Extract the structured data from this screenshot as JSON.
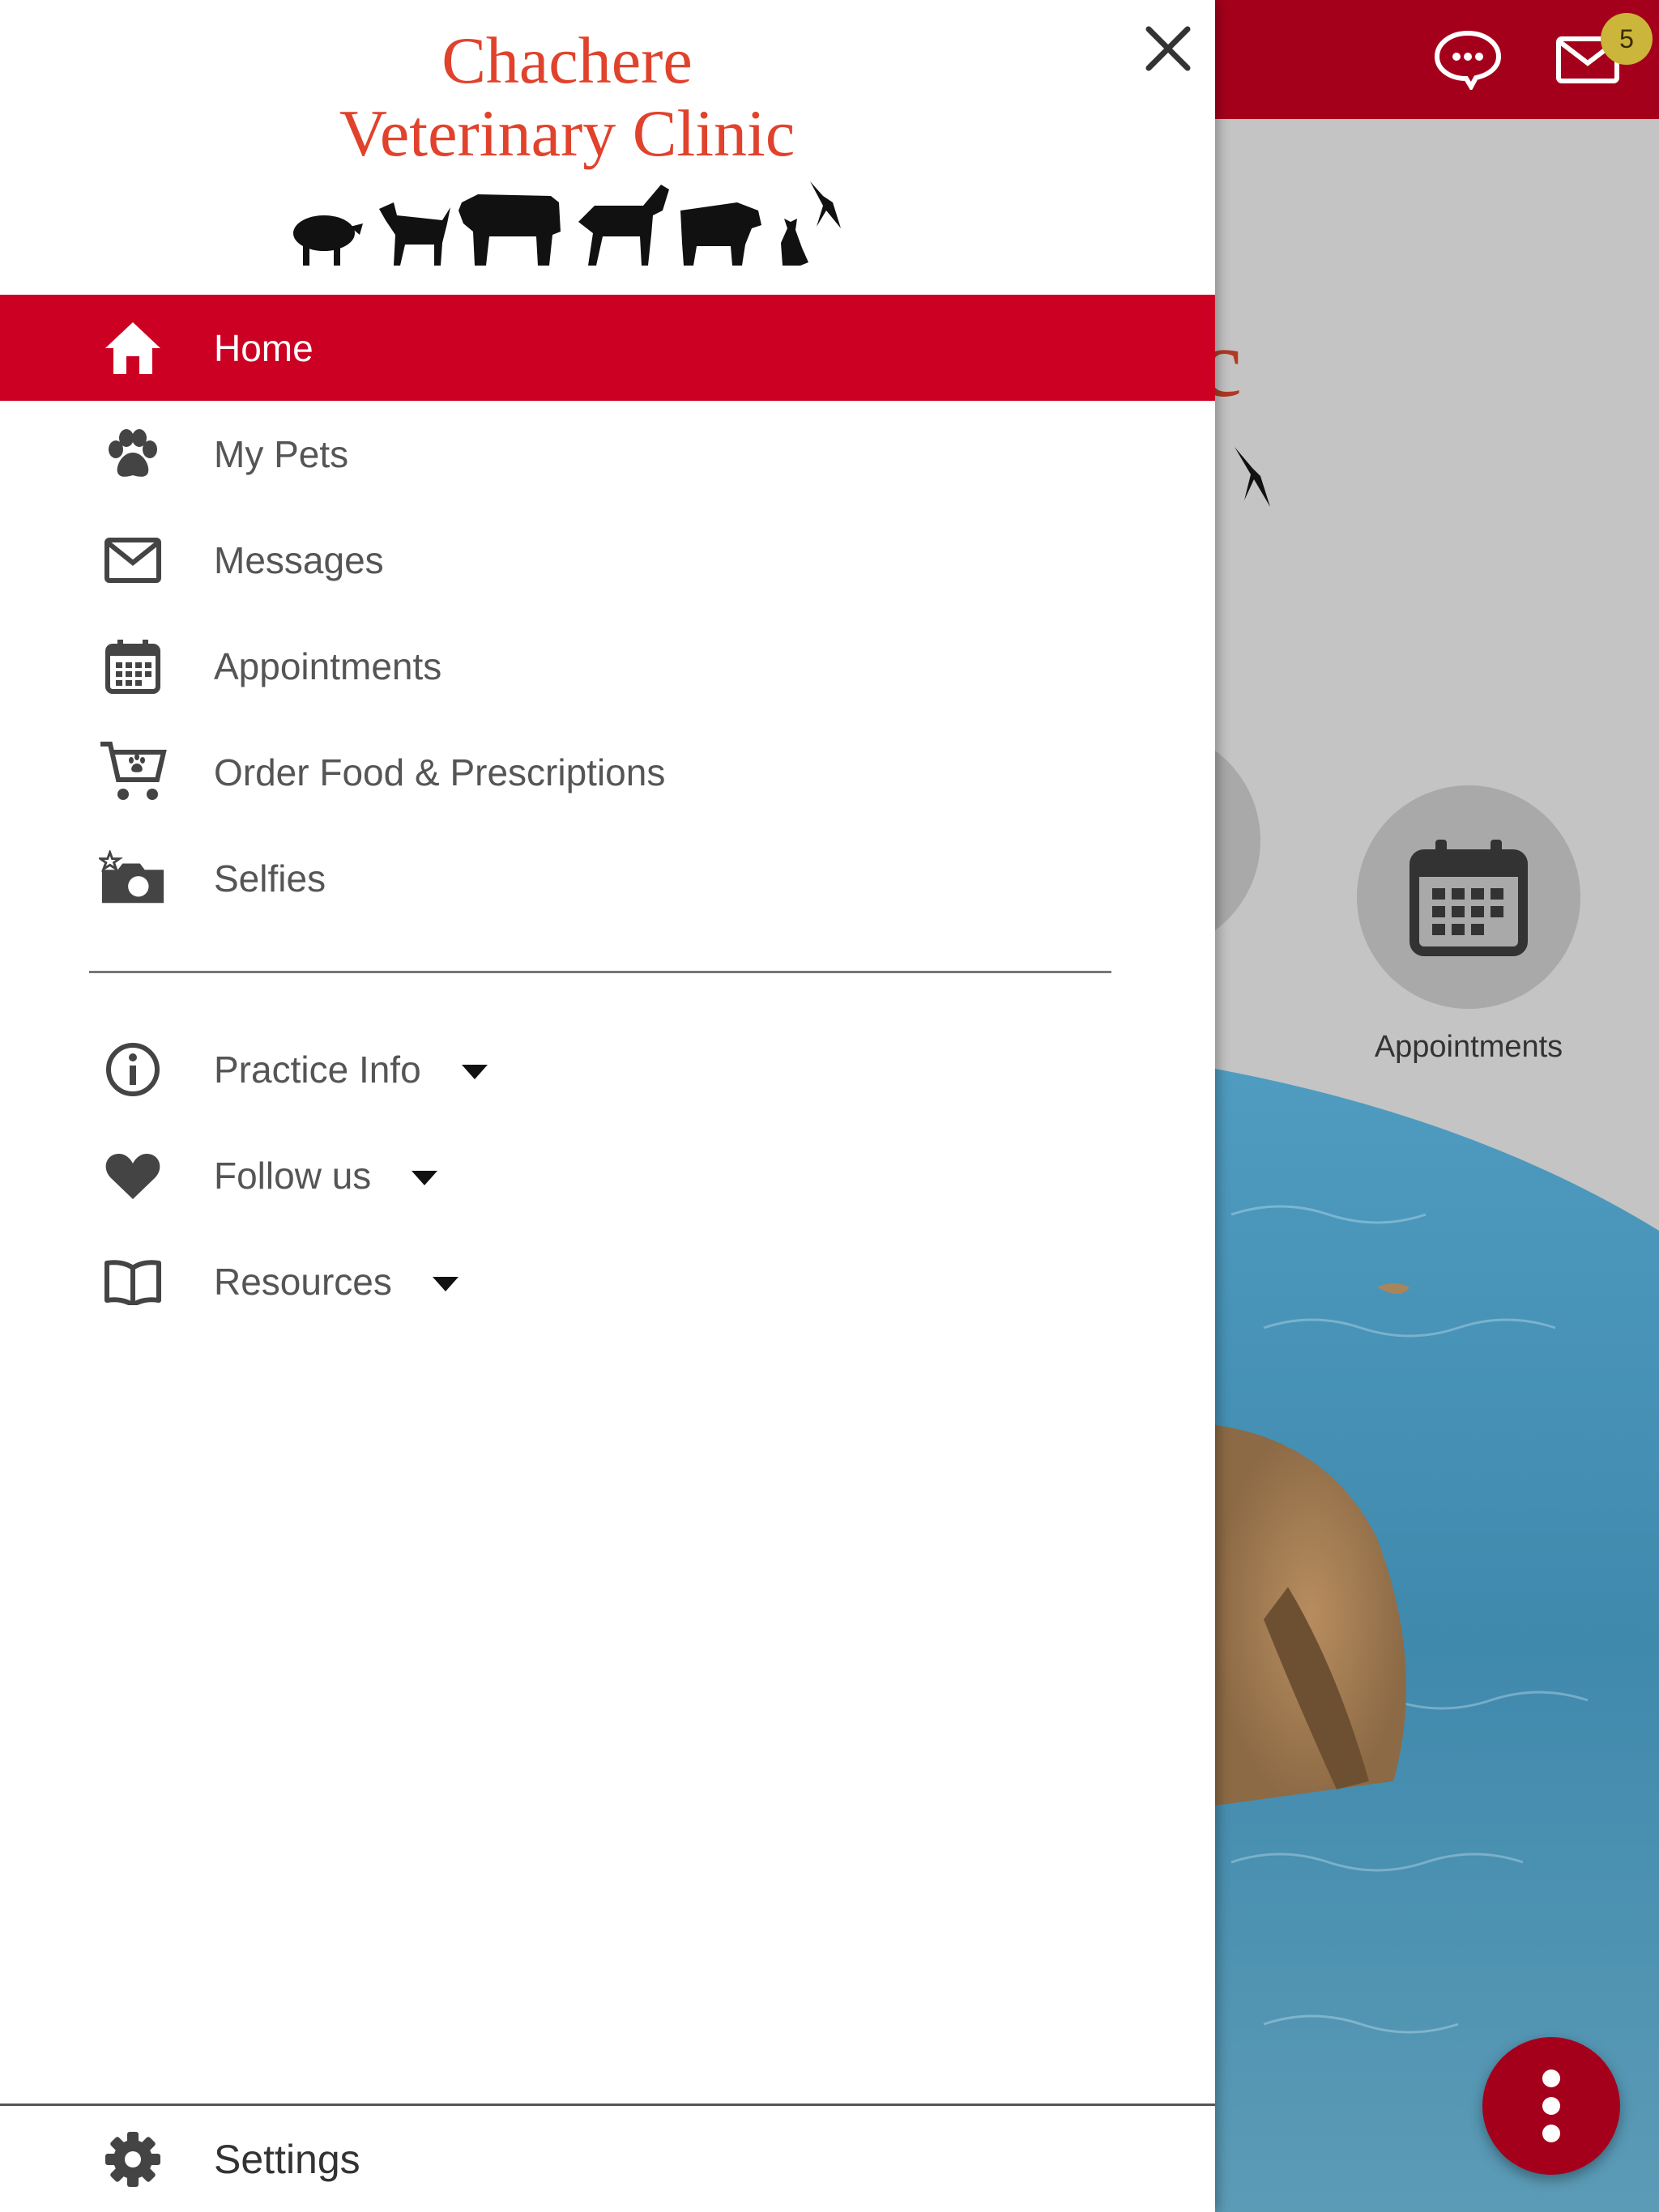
{
  "app": {
    "badge_count": "5",
    "background_label": "Appointments",
    "colors": {
      "topbar": "#a5001b",
      "accent": "#cc0022",
      "logo": "#e0422c"
    }
  },
  "drawer": {
    "logo_line1": "Chachere",
    "logo_line2": "Veterinary Clinic",
    "close_icon": "close-icon",
    "items": [
      {
        "label": "Home",
        "icon": "home-icon",
        "active": true
      },
      {
        "label": "My Pets",
        "icon": "paw-icon"
      },
      {
        "label": "Messages",
        "icon": "envelope-icon"
      },
      {
        "label": "Appointments",
        "icon": "calendar-icon"
      },
      {
        "label": "Order Food & Prescriptions",
        "icon": "cart-icon"
      },
      {
        "label": "Selfies",
        "icon": "camera-icon"
      }
    ],
    "expandables": [
      {
        "label": "Practice Info",
        "icon": "info-icon"
      },
      {
        "label": "Follow us",
        "icon": "heart-icon"
      },
      {
        "label": "Resources",
        "icon": "book-icon"
      }
    ],
    "settings_label": "Settings"
  }
}
